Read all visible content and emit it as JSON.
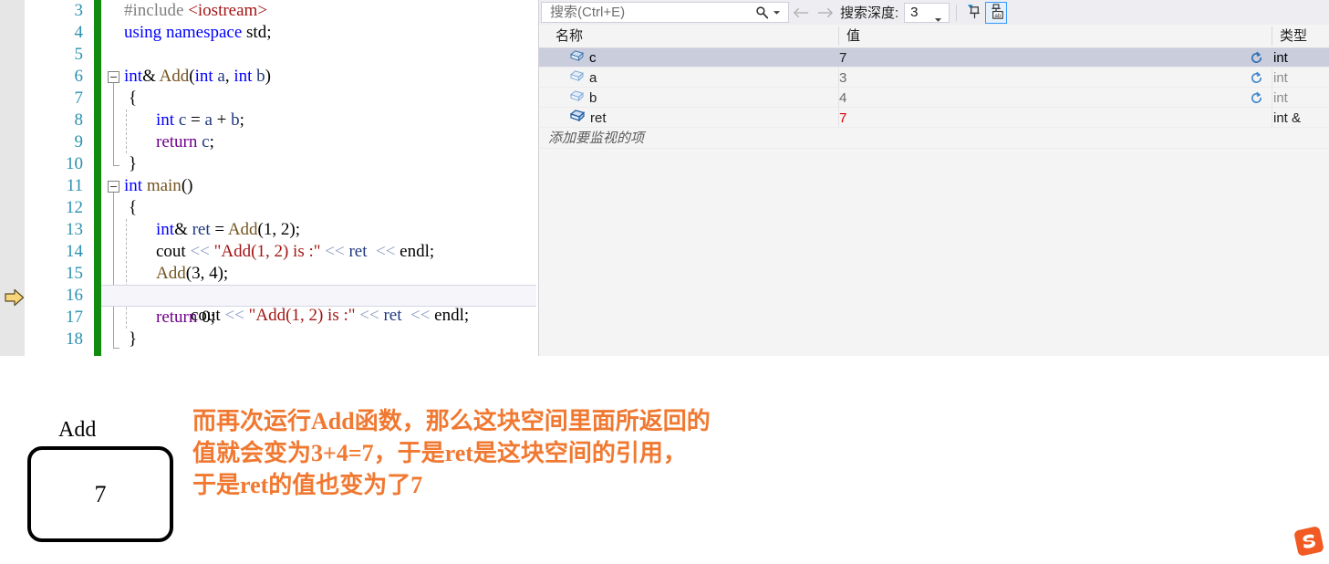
{
  "editor": {
    "current_exec_line": 16,
    "line_numbers": [
      3,
      4,
      5,
      6,
      7,
      8,
      9,
      10,
      11,
      12,
      13,
      14,
      15,
      16,
      17,
      18
    ],
    "lines": [
      {
        "n": 3,
        "text": "#include <iostream>"
      },
      {
        "n": 4,
        "text": "using namespace std;"
      },
      {
        "n": 5,
        "text": ""
      },
      {
        "n": 6,
        "text": "int& Add(int a, int b)"
      },
      {
        "n": 7,
        "text": "{"
      },
      {
        "n": 8,
        "text": "    int c = a + b;"
      },
      {
        "n": 9,
        "text": "    return c;"
      },
      {
        "n": 10,
        "text": "}"
      },
      {
        "n": 11,
        "text": "int main()"
      },
      {
        "n": 12,
        "text": "{"
      },
      {
        "n": 13,
        "text": "    int& ret = Add(1, 2);"
      },
      {
        "n": 14,
        "text": "    cout << \"Add(1, 2) is :\" << ret  << endl;"
      },
      {
        "n": 15,
        "text": "    Add(3, 4);"
      },
      {
        "n": 16,
        "text": "    cout << \"Add(1, 2) is :\" << ret  << endl;"
      },
      {
        "n": 17,
        "text": "    return 0;"
      },
      {
        "n": 18,
        "text": "}"
      }
    ],
    "tokens": {
      "include_directive": "#include",
      "include_header": "<iostream>",
      "using": "using",
      "namespace": "namespace",
      "std": "std;",
      "int": "int",
      "amp": "&",
      "add_fn": "Add",
      "paren_open": "(",
      "paren_close": ")",
      "a": "a",
      "b": "b",
      "c": "c",
      "comma": ", ",
      "brace_open": "{",
      "brace_close": "}",
      "return": "return",
      "main": "main",
      "ret": "ret",
      "cout": "cout",
      "shift": "<<",
      "endl": "endl;",
      "string_literal": "\"Add(1, 2) is :\"",
      "semicolon": ";",
      "zero": "0",
      "one": "1",
      "two": "2",
      "three": "3",
      "four": "4"
    },
    "colors": {
      "keyword": "#0000ff",
      "type": "#2b91af",
      "string": "#a31515",
      "preprocessor": "#808080",
      "operator": "#8b9dc3",
      "macro_purple": "#6f008a",
      "line_number": "#2b91af",
      "change_bar": "#108b10",
      "highlight_row": "#f5f5fa"
    }
  },
  "watch": {
    "toolbar": {
      "search_placeholder": "搜索(Ctrl+E)",
      "search_value": "",
      "search_icon": "search-icon",
      "search_dropdown_icon": "chevron-down-icon",
      "back_icon": "arrow-left-icon",
      "forward_icon": "arrow-right-icon",
      "depth_label": "搜索深度:",
      "depth_value": "3",
      "depth_caret_icon": "chevron-down-icon",
      "pin_icon": "pin-icon",
      "hex_pin_icon": "pin-ab-icon"
    },
    "columns": [
      {
        "key": "name",
        "label": "名称"
      },
      {
        "key": "value",
        "label": "值"
      },
      {
        "key": "type",
        "label": "类型"
      }
    ],
    "rows": [
      {
        "icon": "variable-box-icon",
        "name": "c",
        "value": "7",
        "value_color": "black",
        "type": "int",
        "type_color": "black",
        "refresh": true,
        "selected": true
      },
      {
        "icon": "variable-box-icon",
        "name": "a",
        "value": "3",
        "value_color": "gray",
        "type": "int",
        "type_color": "gray",
        "refresh": true,
        "selected": false
      },
      {
        "icon": "variable-box-icon",
        "name": "b",
        "value": "4",
        "value_color": "gray",
        "type": "int",
        "type_color": "gray",
        "refresh": true,
        "selected": false
      },
      {
        "icon": "variable-box-icon",
        "name": "ret",
        "value": "7",
        "value_color": "red",
        "type": "int &",
        "type_color": "black",
        "refresh": false,
        "selected": false
      }
    ],
    "add_watch_placeholder": "添加要监视的项"
  },
  "annotation": {
    "box_label": "Add",
    "box_value": "7",
    "note_lines": [
      "而再次运行Add函数，那么这块空间里面所返回的",
      "值就会变为3+4=7，于是ret是这块空间的引用，",
      "于是ret的值也变为了7"
    ],
    "note_color": "#f07830",
    "logo": "s-logo-watermark"
  }
}
